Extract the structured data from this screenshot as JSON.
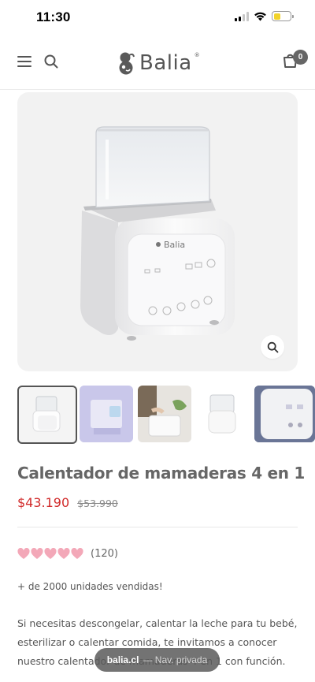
{
  "status_bar": {
    "time": "11:30"
  },
  "header": {
    "logo_text": "Balia",
    "logo_mark": "®",
    "cart_count": "0",
    "icons": [
      "menu-icon",
      "search-icon",
      "cart-icon"
    ]
  },
  "gallery": {
    "main_image": "bottle-warmer-product-photo",
    "device_brand": "Balia",
    "thumbnails": [
      {
        "name": "thumb-bottle-warmer",
        "selected": true
      },
      {
        "name": "thumb-box-packaging",
        "selected": false
      },
      {
        "name": "thumb-lifestyle-hand",
        "selected": false
      },
      {
        "name": "thumb-bottle-warmer-front",
        "selected": false
      },
      {
        "name": "thumb-control-panel-closeup",
        "selected": false
      }
    ]
  },
  "product": {
    "title": "Calentador de mamaderas 4 en 1",
    "price_sale": "$43.190",
    "price_regular": "$53.990",
    "rating": 5,
    "rating_count": "(120)",
    "units_sold": "+ de 2000 unidades vendidas!",
    "description": "Si necesitas descongelar, calentar la leche para tu bebé, esterilizar o calentar comida, te invitamos a conocer nuestro calentador de mamaderas 4 en 1 con función."
  },
  "browser": {
    "domain": "balia.cl",
    "mode_label": "— Nav. privada"
  },
  "colors": {
    "sale_price": "#d12a2a",
    "heart": "#f3a8b8",
    "gallery_bg": "#f2f2f2",
    "battery": "#f2d32a"
  }
}
